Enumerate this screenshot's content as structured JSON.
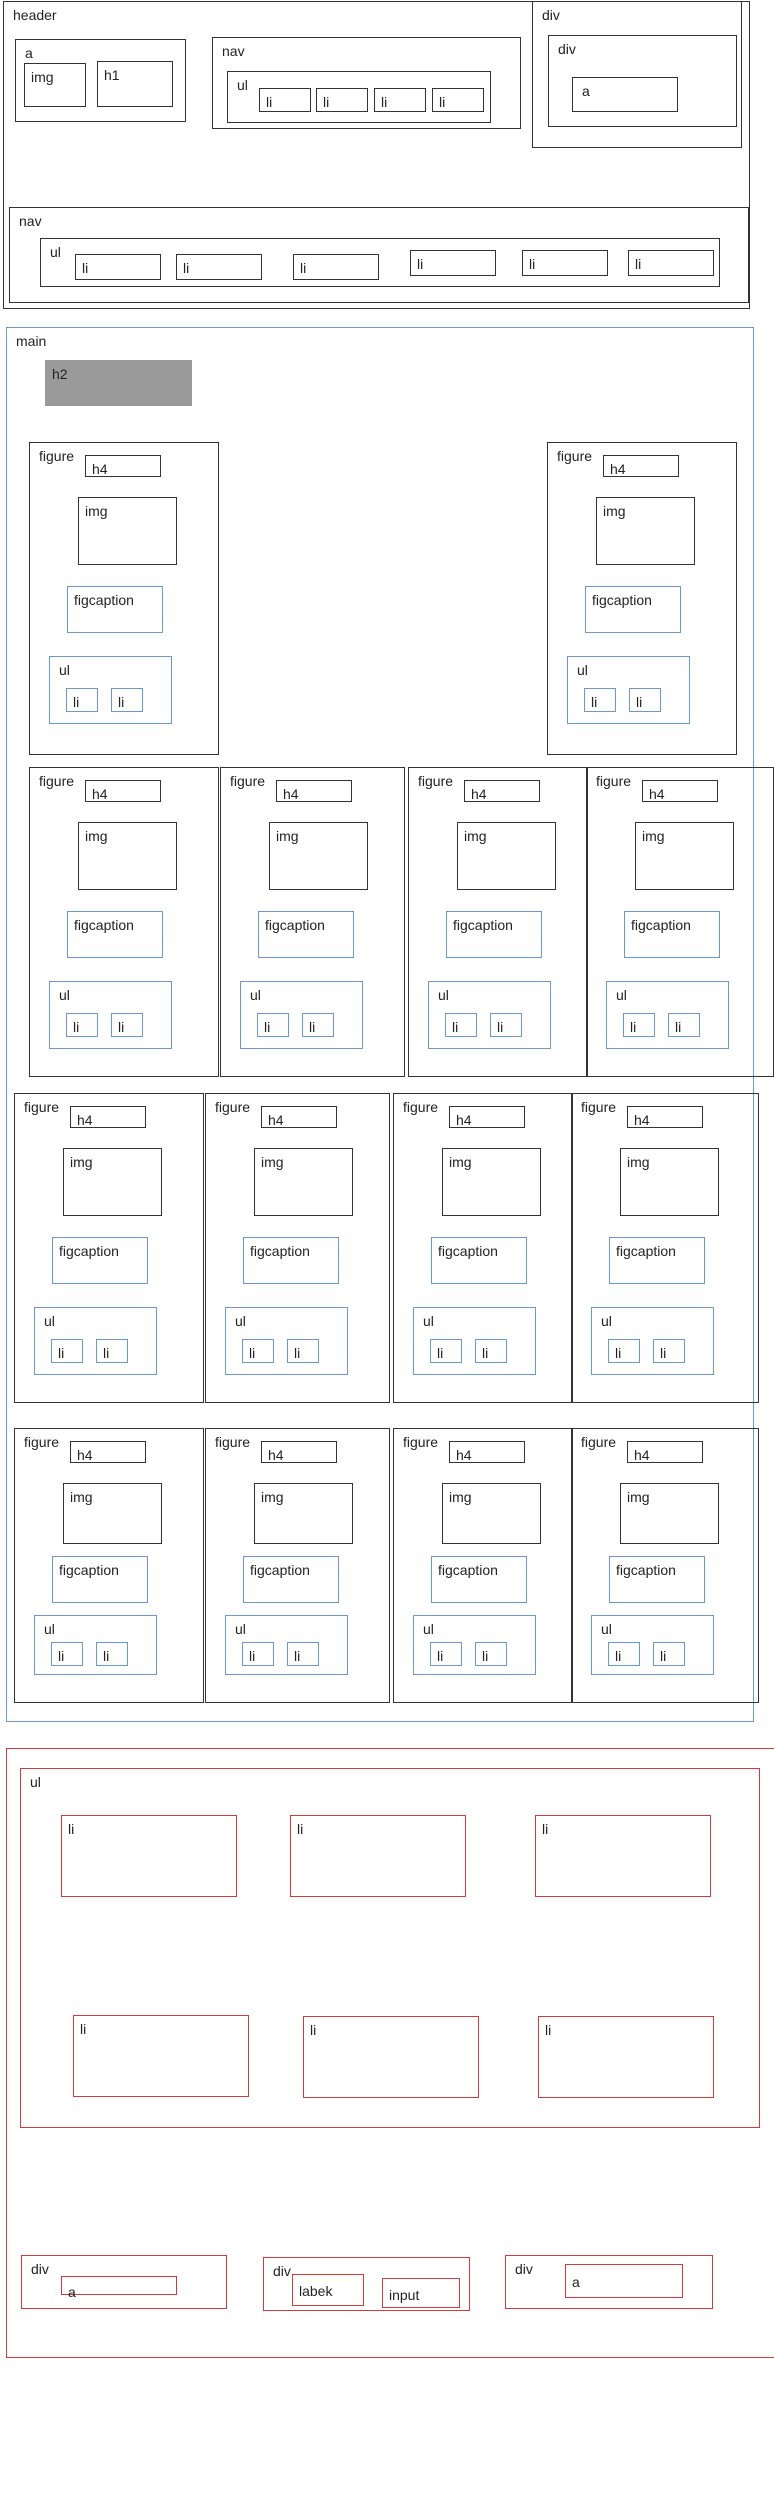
{
  "labels": {
    "header": "header",
    "a": "a",
    "img": "img",
    "h1": "h1",
    "nav": "nav",
    "ul": "ul",
    "li": "li",
    "div": "div",
    "main": "main",
    "h2": "h2",
    "figure": "figure",
    "h4": "h4",
    "figcaption": "figcaption",
    "labek": "labek",
    "input": "input"
  },
  "colors": {
    "structure": "#333333",
    "main_section": "#6b97d3",
    "footer_section": "#d33a3a",
    "h2_fill": "#9a9a9a"
  }
}
